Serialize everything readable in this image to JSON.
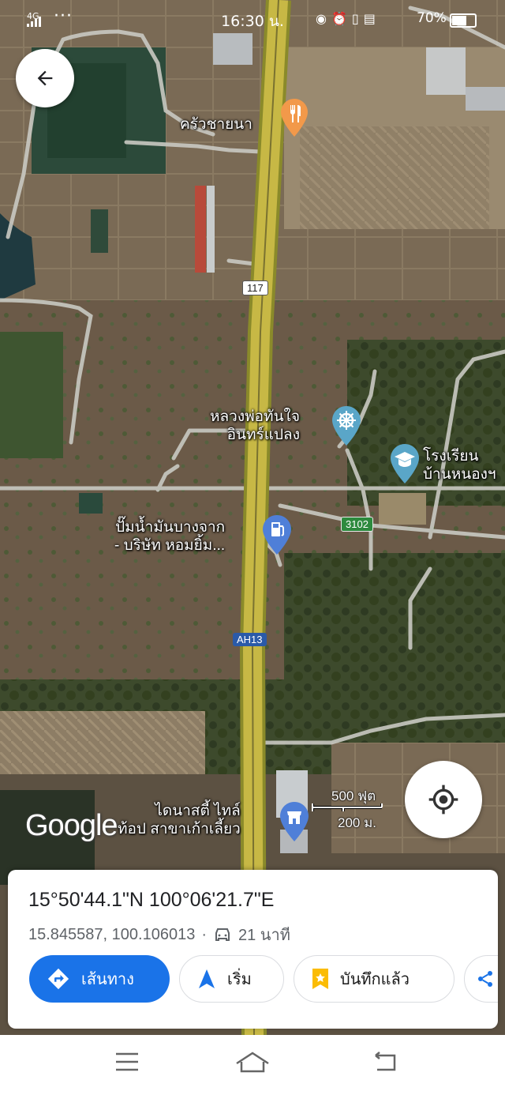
{
  "status_bar": {
    "network": "4G",
    "time": "16:30 น.",
    "battery": "70%",
    "battery_level": 0.7
  },
  "map": {
    "places": [
      {
        "name": "ครัวชายนา",
        "icon": "restaurant-icon"
      },
      {
        "name_line1": "หลวงพ่อทันใจ",
        "name_line2": "อินทร์แปลง",
        "icon": "temple-icon"
      },
      {
        "name_line1": "โรงเรียน",
        "name_line2": "บ้านหนองฯ",
        "icon": "school-icon"
      },
      {
        "name_line1": "ปั๊มน้ำมันบางจาก",
        "name_line2": "- บริษัท หอมยิ้ม...",
        "icon": "gas-station-icon"
      },
      {
        "name_line1": "ไดนาสตี้ ไทล์",
        "name_line2": "ท้อป สาขาเก้าเลี้ยว",
        "icon": "store-icon"
      }
    ],
    "road_shields": {
      "r117": "117",
      "r3102": "3102",
      "ah13": "AH13"
    },
    "scale": {
      "feet": "500 ฟุต",
      "meters": "200 ม."
    },
    "attribution": "Google"
  },
  "sheet": {
    "coordinates_dms": "15°50'44.1\"N 100°06'21.7\"E",
    "coordinates_decimal": "15.845587, 100.106013",
    "separator": "·",
    "drive_time": "21 นาที",
    "actions": {
      "directions": "เส้นทาง",
      "start": "เริ่ม",
      "saved": "บันทึกแล้ว"
    },
    "colors": {
      "accent": "#1a73e8"
    }
  }
}
